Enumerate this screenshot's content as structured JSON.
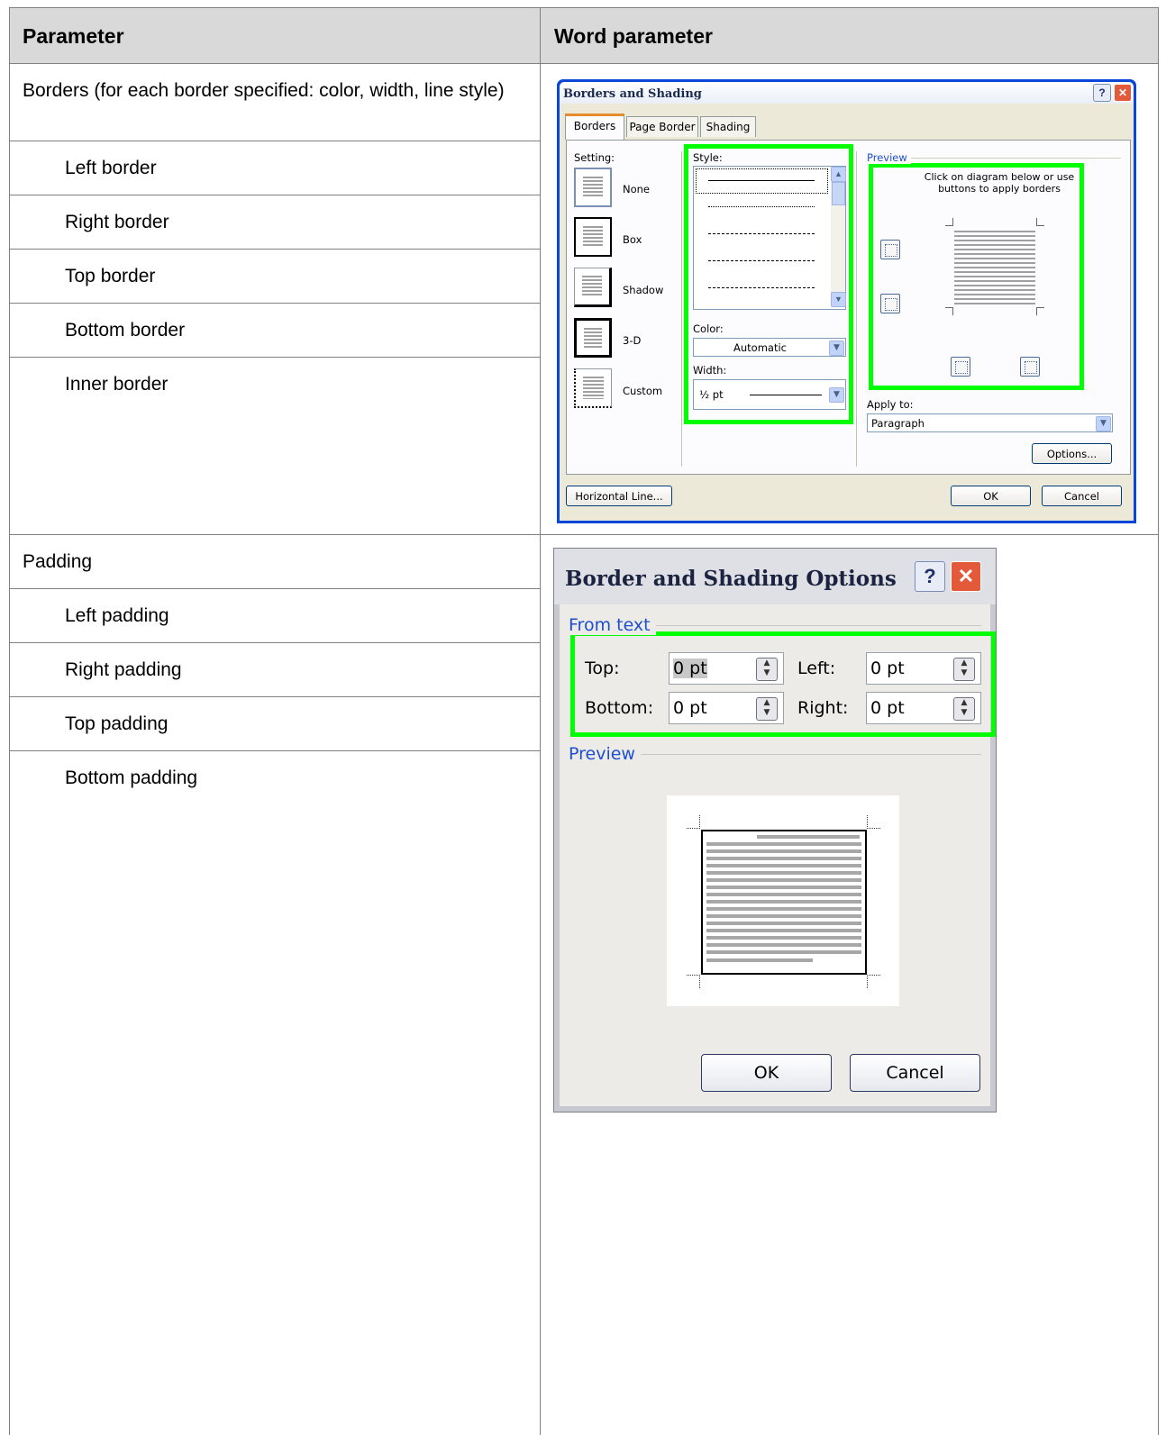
{
  "table": {
    "header": {
      "parameter": "Parameter",
      "word_parameter": "Word parameter"
    },
    "rows": [
      {
        "text": "Borders (for each border specified: color, width, line style)"
      },
      {
        "text": "Left border"
      },
      {
        "text": "Right border"
      },
      {
        "text": "Top border"
      },
      {
        "text": "Bottom border"
      },
      {
        "text": "Inner border"
      },
      {
        "text": "Padding"
      },
      {
        "text": "Left padding"
      },
      {
        "text": "Right padding"
      },
      {
        "text": "Top padding"
      },
      {
        "text": "Bottom padding"
      }
    ]
  },
  "dialog1": {
    "title": "Borders and Shading",
    "help": "?",
    "close": "✕",
    "tabs": [
      "Borders",
      "Page Border",
      "Shading"
    ],
    "setting_label": "Setting:",
    "settings": [
      "None",
      "Box",
      "Shadow",
      "3-D",
      "Custom"
    ],
    "style_label": "Style:",
    "color_label": "Color:",
    "color_value": "Automatic",
    "width_label": "Width:",
    "width_value": "½ pt",
    "preview_label": "Preview",
    "preview_hint": "Click on diagram below or use buttons to apply borders",
    "apply_label": "Apply to:",
    "apply_value": "Paragraph",
    "options_button": "Options...",
    "horizontal_line_button": "Horizontal Line...",
    "ok_button": "OK",
    "cancel_button": "Cancel"
  },
  "dialog2": {
    "title": "Border and Shading Options",
    "help": "?",
    "close": "✕",
    "from_text_label": "From text",
    "top_label": "Top:",
    "top_value": "0 pt",
    "left_label": "Left:",
    "left_value": "0 pt",
    "bottom_label": "Bottom:",
    "bottom_value": "0 pt",
    "right_label": "Right:",
    "right_value": "0 pt",
    "preview_label": "Preview",
    "ok_button": "OK",
    "cancel_button": "Cancel"
  },
  "colors": {
    "highlight": "#00ff00",
    "header_bg": "#d9d9d9",
    "xp_blue": "#0a46d8"
  }
}
